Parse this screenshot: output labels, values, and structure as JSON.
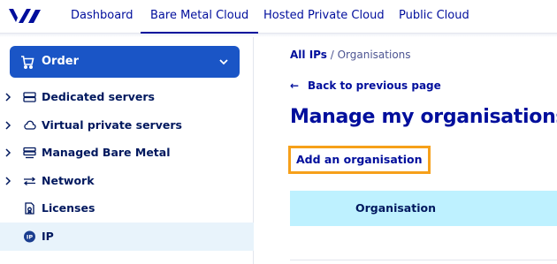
{
  "topnav": {
    "logo": "ovh-logo",
    "items": [
      {
        "label": "Dashboard",
        "active": false
      },
      {
        "label": "Bare Metal Cloud",
        "active": true
      },
      {
        "label": "Hosted Private Cloud",
        "active": false
      },
      {
        "label": "Public Cloud",
        "active": false
      }
    ]
  },
  "sidebar": {
    "order_label": "Order",
    "items": [
      {
        "label": "Dedicated servers",
        "icon": "server-icon",
        "expandable": true
      },
      {
        "label": "Virtual private servers",
        "icon": "cloud-icon",
        "expandable": true
      },
      {
        "label": "Managed Bare Metal",
        "icon": "stack-icon",
        "expandable": true
      },
      {
        "label": "Network",
        "icon": "network-icon",
        "expandable": true
      },
      {
        "label": "Licenses",
        "icon": "license-icon",
        "expandable": false
      },
      {
        "label": "IP",
        "icon": "ip-icon",
        "expandable": false,
        "active": true
      }
    ]
  },
  "main": {
    "breadcrumb": {
      "link": "All IPs",
      "separator": "/",
      "current": "Organisations"
    },
    "back_link": "Back to previous page",
    "title": "Manage my organisations",
    "add_link": "Add an organisation",
    "table": {
      "columns": [
        "Organisation"
      ]
    }
  },
  "colors": {
    "brand": "#000e9c",
    "order_button": "#1a55c6",
    "highlight": "#f6a01a",
    "table_header": "#bef1ff",
    "active_item": "#e8f3fb"
  }
}
